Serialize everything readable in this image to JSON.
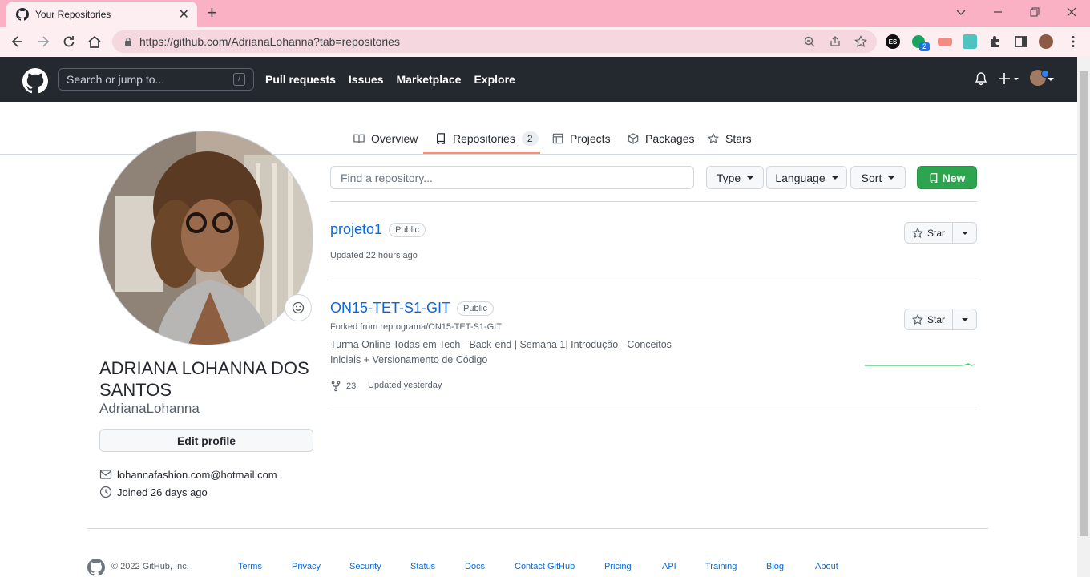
{
  "browser": {
    "tab_title": "Your Repositories",
    "tab_close": "✕",
    "new_tab": "+",
    "url": "https://github.com/AdrianaLohanna?tab=repositories",
    "ext_es": "ES",
    "ext_badge": "2"
  },
  "header": {
    "search_placeholder": "Search or jump to...",
    "search_hotkey": "/",
    "nav": [
      "Pull requests",
      "Issues",
      "Marketplace",
      "Explore"
    ]
  },
  "tabs": {
    "overview": "Overview",
    "repositories": "Repositories",
    "repositories_count": "2",
    "projects": "Projects",
    "packages": "Packages",
    "stars": "Stars"
  },
  "profile": {
    "full_name": "ADRIANA LOHANNA DOS SANTOS",
    "login": "AdrianaLohanna",
    "edit_label": "Edit profile",
    "email": "lohannafashion.com@hotmail.com",
    "joined": "Joined 26 days ago"
  },
  "repo_controls": {
    "filter_placeholder": "Find a repository...",
    "type_label": "Type",
    "language_label": "Language",
    "sort_label": "Sort",
    "new_label": "New"
  },
  "repos": [
    {
      "name": "projeto1",
      "visibility": "Public",
      "updated": "Updated 22 hours ago",
      "star_label": "Star"
    },
    {
      "name": "ON15-TET-S1-GIT",
      "visibility": "Public",
      "forked_from": "Forked from reprograma/ON15-TET-S1-GIT",
      "description": "Turma Online Todas em Tech - Back-end | Semana 1| Introdução - Conceitos Iniciais + Versionamento de Código",
      "forks": "23",
      "updated": "Updated yesterday",
      "star_label": "Star"
    }
  ],
  "footer": {
    "copyright": "© 2022 GitHub, Inc.",
    "links": [
      "Terms",
      "Privacy",
      "Security",
      "Status",
      "Docs",
      "Contact GitHub",
      "Pricing",
      "API",
      "Training",
      "Blog",
      "About"
    ]
  },
  "colors": {
    "chrome_tabstrip": "#fbb1c4",
    "header_bg": "#24292f",
    "link": "#0969da",
    "primary_green": "#2da44e",
    "active_tab_underline": "#fd8c73"
  }
}
